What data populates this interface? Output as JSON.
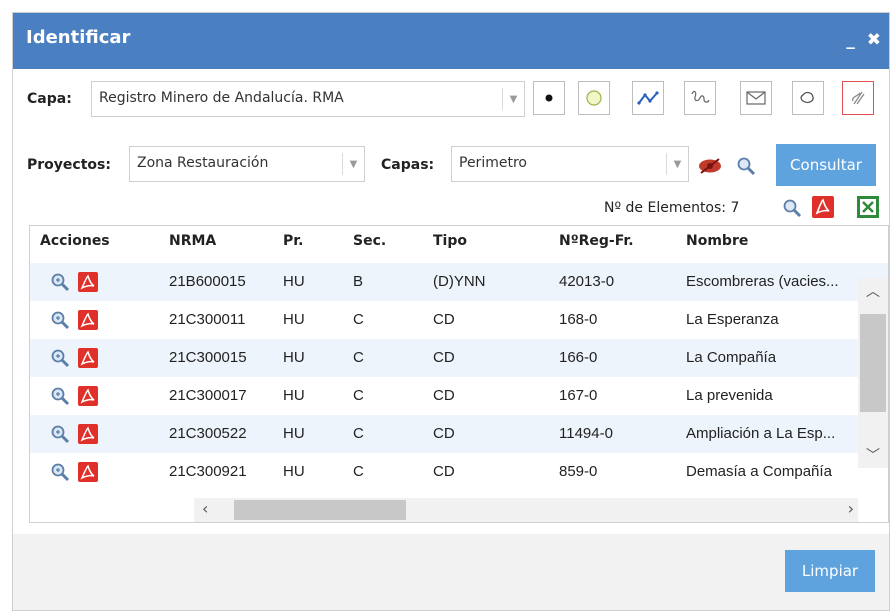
{
  "window": {
    "title": "Identificar",
    "minimize": "_",
    "close": "✖"
  },
  "capa": {
    "label": "Capa:",
    "value": "Registro Minero de Andalucía. RMA"
  },
  "tools": [
    "point-icon",
    "circle-icon",
    "polyline-icon",
    "freehand-icon",
    "envelope-icon",
    "lasso-icon",
    "eraser-icon"
  ],
  "proyectos": {
    "label": "Proyectos:",
    "value": "Zona Restauración"
  },
  "capas": {
    "label": "Capas:",
    "value": "Perimetro"
  },
  "consultar_label": "Consultar",
  "count": {
    "label": "Nº de Elementos: 7"
  },
  "table": {
    "headers": [
      "Acciones",
      "NRMA",
      "Pr.",
      "Sec.",
      "Tipo",
      "NºReg-Fr.",
      "Nombre"
    ],
    "rows": [
      [
        "21B600015",
        "HU",
        "B",
        "(D)YNN",
        "42013-0",
        "Escombreras (vacies..."
      ],
      [
        "21C300011",
        "HU",
        "C",
        "CD",
        "168-0",
        "La Esperanza"
      ],
      [
        "21C300015",
        "HU",
        "C",
        "CD",
        "166-0",
        "La Compañía"
      ],
      [
        "21C300017",
        "HU",
        "C",
        "CD",
        "167-0",
        "La prevenida"
      ],
      [
        "21C300522",
        "HU",
        "C",
        "CD",
        "11494-0",
        "Ampliación a La Esp..."
      ],
      [
        "21C300921",
        "HU",
        "C",
        "CD",
        "859-0",
        "Demasía a Compañía"
      ]
    ]
  },
  "limpiar_label": "Limpiar",
  "colors": {
    "titlebar": "#4a7fc1",
    "button": "#5ea3de",
    "row_alt": "#eef4fb",
    "pdf": "#e0302a",
    "excel": "#2f8a3a"
  }
}
